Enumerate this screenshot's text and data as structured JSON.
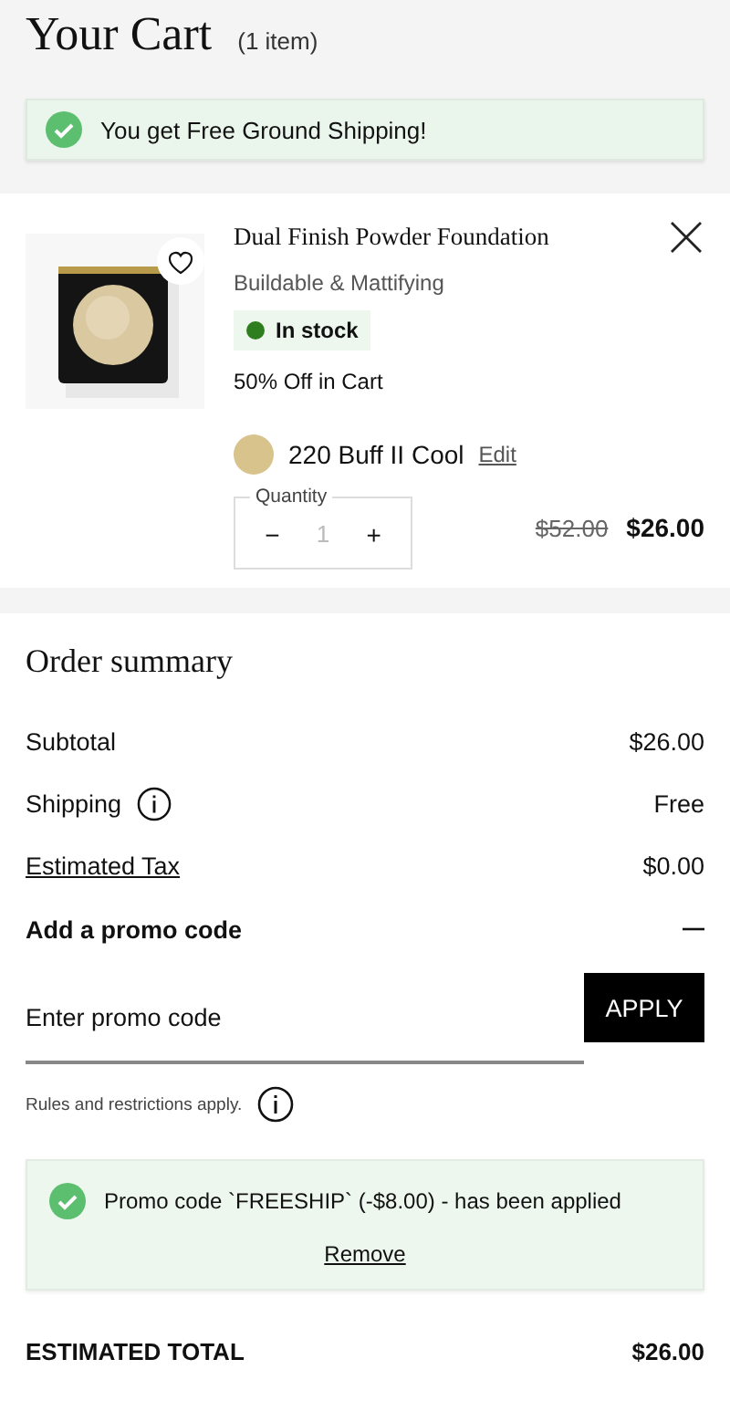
{
  "header": {
    "title": "Your Cart",
    "count": "(1 item)"
  },
  "shipping_banner": {
    "text": "You get Free Ground Shipping!"
  },
  "item": {
    "name": "Dual Finish Powder Foundation",
    "subtitle": "Buildable & Mattifying",
    "in_stock": true,
    "stock_label": "In stock",
    "offer": "50% Off in Cart",
    "favorite": false,
    "shade": {
      "name": "220 Buff II Cool",
      "color": "#d8c38c",
      "edit": "Edit"
    },
    "quantity": {
      "label": "Quantity",
      "value": "1",
      "minus": "−",
      "plus": "+"
    },
    "original_price": "$52.00",
    "price": "$26.00"
  },
  "summary": {
    "title": "Order summary",
    "rows": [
      {
        "kind": "plain",
        "label": "Subtotal",
        "value": "$26.00"
      },
      {
        "kind": "info",
        "label": "Shipping",
        "value": "Free"
      },
      {
        "kind": "link",
        "label": "Estimated Tax",
        "value": "$0.00"
      }
    ],
    "promo": {
      "title": "Add a promo code",
      "expanded": true,
      "placeholder": "Enter promo code",
      "apply": "APPLY",
      "rules": "Rules and restrictions apply.",
      "applied_message": "Promo code `FREESHIP` (-$8.00) - has been applied",
      "remove": "Remove"
    },
    "total_label": "ESTIMATED TOTAL",
    "total_value": "$26.00"
  }
}
